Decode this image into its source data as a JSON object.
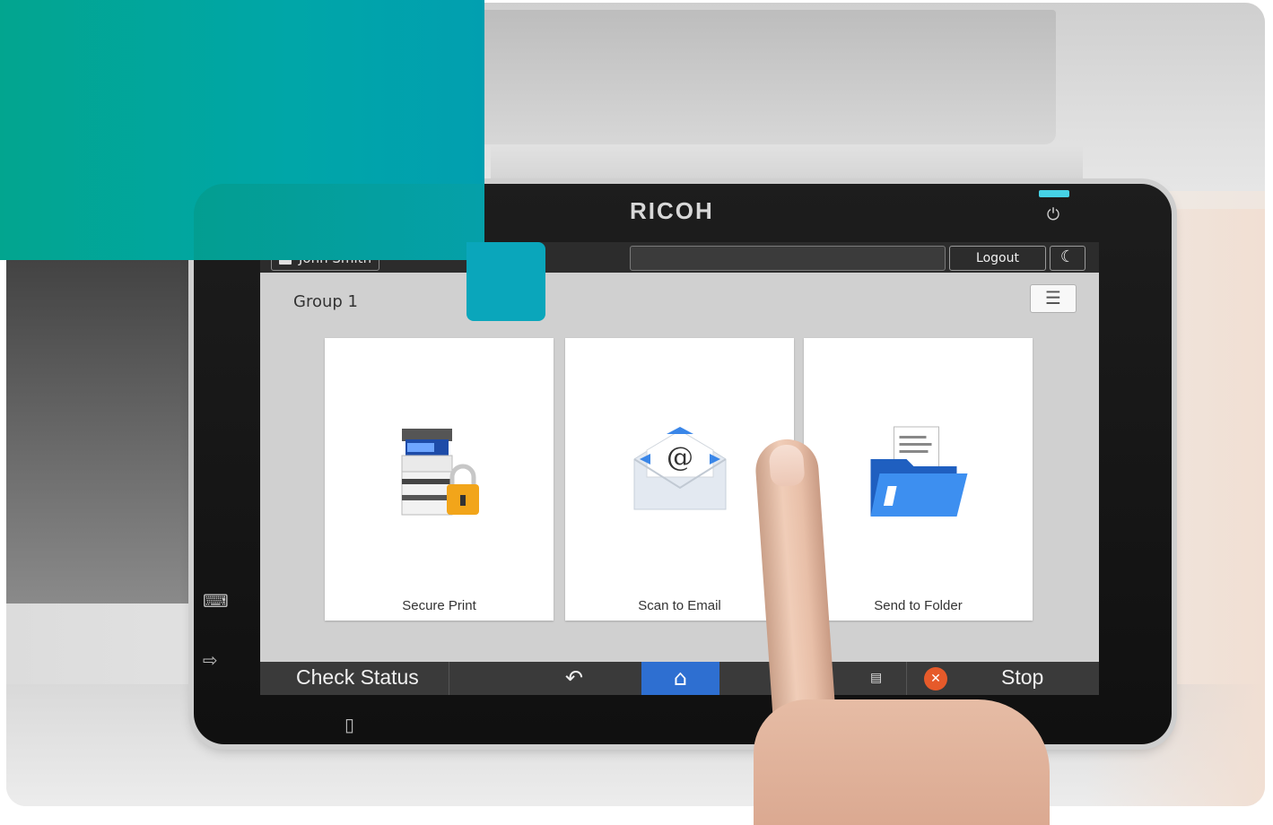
{
  "device": {
    "brand": "RICOH"
  },
  "status_bar": {
    "user_name": "John Smith",
    "logout_label": "Logout",
    "sleep_icon": "moon-icon"
  },
  "screen": {
    "group_title": "Group 1",
    "menu_icon": "list-menu-icon",
    "tiles": [
      {
        "label": "Secure Print",
        "icon": "printer-lock-icon"
      },
      {
        "label": "Scan to Email",
        "icon": "email-envelope-icon"
      },
      {
        "label": "Send to Folder",
        "icon": "document-folder-icon"
      }
    ]
  },
  "bottom_bar": {
    "check_status_label": "Check Status",
    "back_icon": "back-arrow-icon",
    "home_icon": "home-icon",
    "stop_label": "Stop",
    "home_color": "#2e6fd1",
    "stop_color": "#e65a2a"
  },
  "colors": {
    "accent_teal": "#00a6a8"
  }
}
